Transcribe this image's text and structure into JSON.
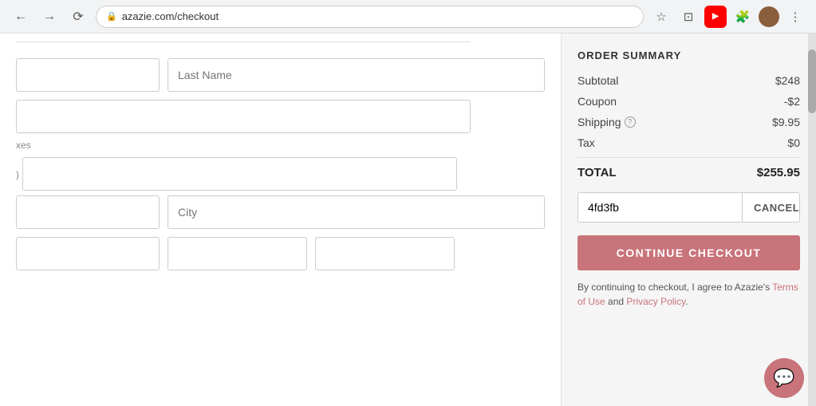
{
  "browser": {
    "url": "azazie.com/checkout",
    "back_title": "Back",
    "forward_title": "Forward",
    "reload_title": "Reload"
  },
  "form": {
    "last_name_placeholder": "Last Name",
    "city_placeholder": "City",
    "suffix_label": "xes",
    "parenthesis_label": ")"
  },
  "order_summary": {
    "title": "ORDER SUMMARY",
    "subtotal_label": "Subtotal",
    "subtotal_value": "$248",
    "coupon_label": "Coupon",
    "coupon_value": "-$2",
    "shipping_label": "Shipping",
    "shipping_value": "$9.95",
    "tax_label": "Tax",
    "tax_value": "$0",
    "total_label": "TOTAL",
    "total_value": "$255.95",
    "coupon_code": "4fd3fb",
    "cancel_label": "CANCEL",
    "continue_label": "CONTINUE CHECKOUT",
    "terms_text": "By continuing to checkout, I agree to Azazie's",
    "terms_of_use": "Terms of Use",
    "terms_and": "and",
    "privacy_policy": "Privacy Policy",
    "terms_period": "."
  },
  "chat": {
    "icon": "💬"
  }
}
